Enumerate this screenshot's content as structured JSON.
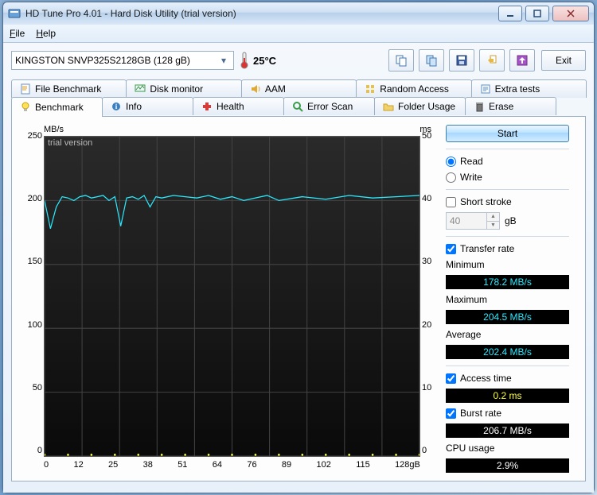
{
  "window": {
    "title": "HD Tune Pro 4.01 - Hard Disk Utility (trial version)"
  },
  "menu": {
    "file": "File",
    "help": "Help"
  },
  "toolbar": {
    "drive": "KINGSTON SNVP325S2128GB (128 gB)",
    "temperature": "25°C",
    "exit": "Exit"
  },
  "tabs_top": {
    "file_benchmark": "File Benchmark",
    "disk_monitor": "Disk monitor",
    "aam": "AAM",
    "random_access": "Random Access",
    "extra_tests": "Extra tests"
  },
  "tabs_bottom": {
    "benchmark": "Benchmark",
    "info": "Info",
    "health": "Health",
    "error_scan": "Error Scan",
    "folder_usage": "Folder Usage",
    "erase": "Erase"
  },
  "chart": {
    "y_left_unit": "MB/s",
    "y_right_unit": "ms",
    "trial_watermark": "trial version",
    "y_left_ticks": [
      "250",
      "200",
      "150",
      "100",
      "50",
      "0"
    ],
    "y_right_ticks": [
      "50",
      "40",
      "30",
      "20",
      "10",
      "0"
    ],
    "x_ticks": [
      "0",
      "12",
      "25",
      "38",
      "51",
      "64",
      "76",
      "89",
      "102",
      "115",
      "128gB"
    ]
  },
  "side": {
    "start": "Start",
    "read": "Read",
    "write": "Write",
    "short_stroke": "Short stroke",
    "short_stroke_value": "40",
    "short_stroke_unit": "gB",
    "transfer_rate": "Transfer rate",
    "minimum_label": "Minimum",
    "minimum_value": "178.2 MB/s",
    "maximum_label": "Maximum",
    "maximum_value": "204.5 MB/s",
    "average_label": "Average",
    "average_value": "202.4 MB/s",
    "access_time": "Access time",
    "access_time_value": "0.2 ms",
    "burst_rate": "Burst rate",
    "burst_rate_value": "206.7 MB/s",
    "cpu_usage": "CPU usage",
    "cpu_usage_value": "2.9%"
  },
  "chart_data": {
    "type": "line",
    "title": "",
    "xlabel": "gB",
    "ylabel_left": "MB/s",
    "ylabel_right": "ms",
    "xlim": [
      0,
      128
    ],
    "ylim_left": [
      0,
      250
    ],
    "ylim_right": [
      0,
      50
    ],
    "series": [
      {
        "name": "Transfer rate (MB/s)",
        "axis": "left",
        "color": "#29eaff",
        "x": [
          0,
          2,
          4,
          6,
          8,
          10,
          12,
          14,
          16,
          18,
          20,
          22,
          24,
          26,
          28,
          30,
          32,
          34,
          36,
          38,
          40,
          44,
          48,
          52,
          56,
          60,
          64,
          68,
          72,
          76,
          80,
          88,
          96,
          104,
          112,
          120,
          128
        ],
        "y": [
          200,
          178,
          195,
          203,
          202,
          200,
          203,
          204,
          202,
          203,
          204,
          200,
          203,
          180,
          202,
          203,
          201,
          204,
          195,
          203,
          202,
          204,
          203,
          202,
          204,
          201,
          203,
          200,
          202,
          204,
          200,
          203,
          201,
          204,
          202,
          203,
          204
        ]
      },
      {
        "name": "Access time (ms)",
        "axis": "right",
        "color": "#ffff3b",
        "x": [
          0,
          8,
          16,
          24,
          32,
          40,
          48,
          56,
          64,
          72,
          80,
          88,
          96,
          104,
          112,
          120,
          128
        ],
        "y": [
          0.2,
          0.2,
          0.2,
          0.2,
          0.2,
          0.2,
          0.2,
          0.2,
          0.2,
          0.2,
          0.2,
          0.2,
          0.2,
          0.2,
          0.2,
          0.2,
          0.2
        ]
      }
    ]
  }
}
